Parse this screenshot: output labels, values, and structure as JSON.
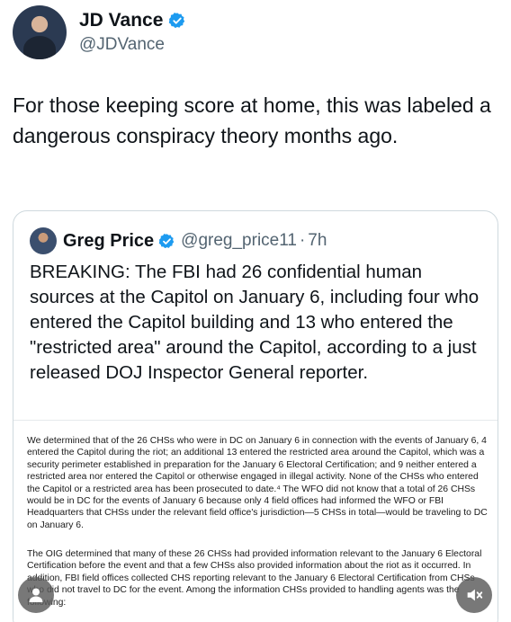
{
  "author": {
    "display_name": "JD Vance",
    "handle": "@JDVance"
  },
  "tweet": {
    "text": "For those keeping score at home, this was labeled a dangerous conspiracy theory months ago."
  },
  "quoted": {
    "display_name": "Greg Price",
    "handle": "@greg_price11",
    "separator": "·",
    "time": "7h",
    "text": "BREAKING: The FBI had 26 confidential human sources at the Capitol on January 6, including four who entered the Capitol building and 13 who entered the \"restricted area\" around the Capitol, according to a just released DOJ Inspector General reporter.",
    "document": {
      "paragraph_1": "We determined that of the 26 CHSs who were in DC on January 6 in connection with the events of January 6, 4 entered the Capitol during the riot; an additional 13 entered the restricted area around the Capitol, which was a security perimeter established in preparation for the January 6 Electoral Certification; and 9 neither entered a restricted area nor entered the Capitol or otherwise engaged in illegal activity. None of the CHSs who entered the Capitol or a restricted area has been prosecuted to date.⁴ The WFO did not know that a total of 26 CHSs would be in DC for the events of January 6 because only 4 field offices had informed the WFO or FBI Headquarters that CHSs under the relevant field office's jurisdiction—5 CHSs in total—would be traveling to DC on January 6.",
      "paragraph_2": "The OIG determined that many of these 26 CHSs had provided information relevant to the January 6 Electoral Certification before the event and that a few CHSs also provided information about the riot as it occurred. In addition, FBI field offices collected CHS reporting relevant to the January 6 Electoral Certification from CHSs who did not travel to DC for the event. Among the information CHSs provided to handling agents was the following:"
    }
  },
  "overlay_icons": {
    "left": "user-icon",
    "right": "mute-icon"
  },
  "colors": {
    "verified": "#1d9bf0",
    "secondary_text": "#536471",
    "border": "#cfd9de"
  }
}
